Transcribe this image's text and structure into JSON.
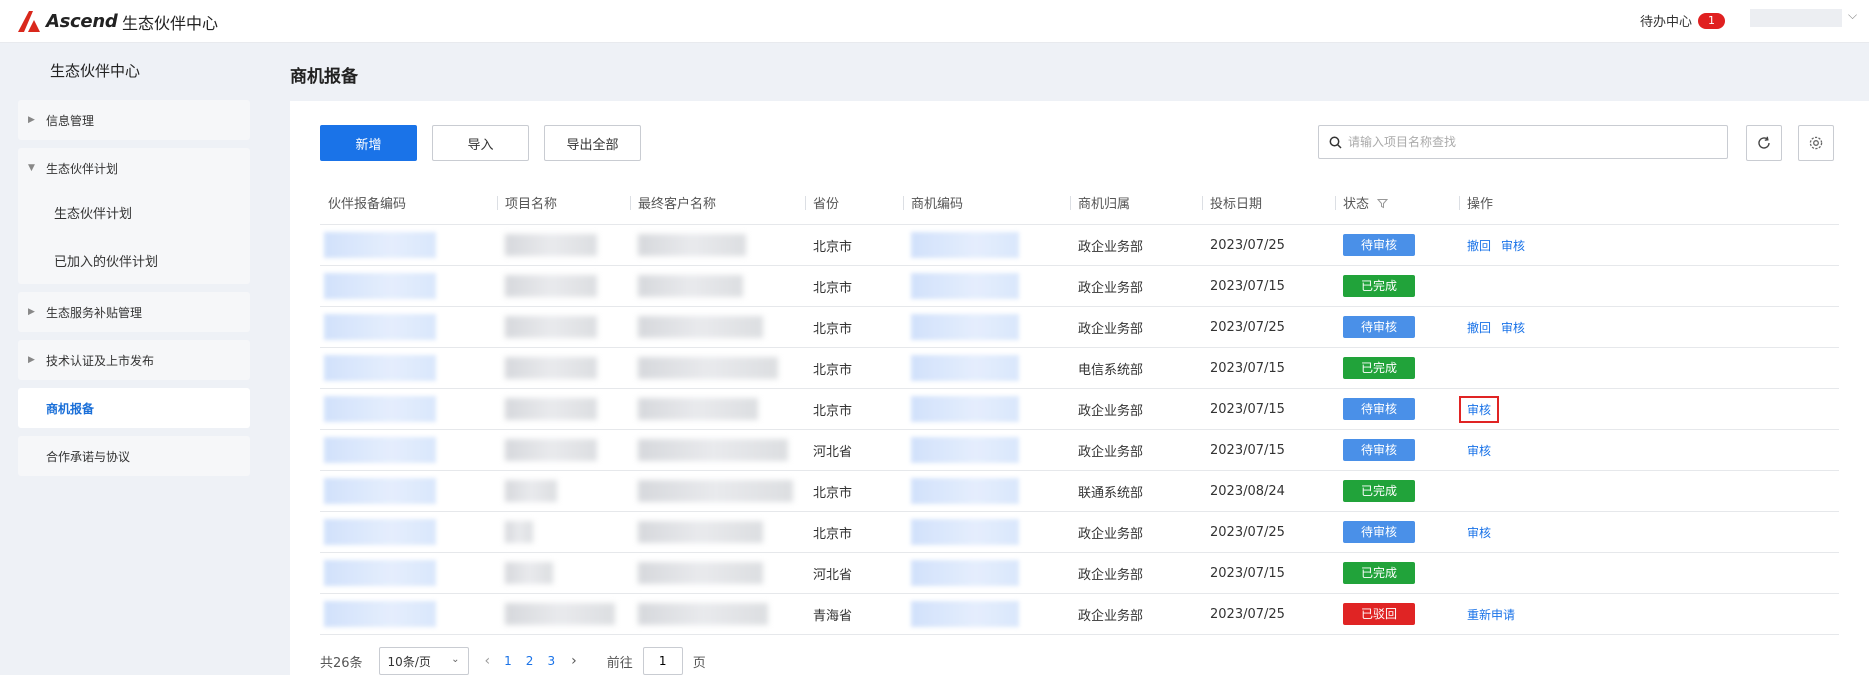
{
  "topbar": {
    "logo_text": "Ascend",
    "app_title": "生态伙伴中心",
    "todo_label": "待办中心",
    "todo_count": "1"
  },
  "sidebar": {
    "title": "生态伙伴中心",
    "groups": [
      {
        "label": "信息管理",
        "expanded": false
      },
      {
        "label": "生态伙伴计划",
        "expanded": true,
        "children": [
          "生态伙伴计划",
          "已加入的伙伴计划"
        ]
      },
      {
        "label": "生态服务补贴管理",
        "expanded": false
      },
      {
        "label": "技术认证及上市发布",
        "expanded": false
      },
      {
        "label": "商机报备",
        "active": true
      },
      {
        "label": "合作承诺与协议"
      }
    ]
  },
  "page": {
    "title": "商机报备",
    "toolbar": {
      "add_label": "新增",
      "import_label": "导入",
      "export_label": "导出全部",
      "search_placeholder": "请输入项目名称查找"
    },
    "table": {
      "columns": [
        "伙伴报备编码",
        "项目名称",
        "最终客户名称",
        "省份",
        "商机编码",
        "商机归属",
        "投标日期",
        "状态",
        "操作"
      ],
      "rows": [
        {
          "province": "北京市",
          "owner": "政企业务部",
          "date": "2023/07/25",
          "status": "待审核",
          "status_kind": "pending",
          "ops": [
            "撤回",
            "审核"
          ]
        },
        {
          "province": "北京市",
          "owner": "政企业务部",
          "date": "2023/07/15",
          "status": "已完成",
          "status_kind": "done",
          "ops": []
        },
        {
          "province": "北京市",
          "owner": "政企业务部",
          "date": "2023/07/25",
          "status": "待审核",
          "status_kind": "pending",
          "ops": [
            "撤回",
            "审核"
          ]
        },
        {
          "province": "北京市",
          "owner": "电信系统部",
          "date": "2023/07/15",
          "status": "已完成",
          "status_kind": "done",
          "ops": []
        },
        {
          "province": "北京市",
          "owner": "政企业务部",
          "date": "2023/07/15",
          "status": "待审核",
          "status_kind": "pending",
          "ops": [
            "审核"
          ],
          "highlight": true
        },
        {
          "province": "河北省",
          "owner": "政企业务部",
          "date": "2023/07/15",
          "status": "待审核",
          "status_kind": "pending",
          "ops": [
            "审核"
          ]
        },
        {
          "province": "北京市",
          "owner": "联通系统部",
          "date": "2023/08/24",
          "status": "已完成",
          "status_kind": "done",
          "ops": []
        },
        {
          "province": "北京市",
          "owner": "政企业务部",
          "date": "2023/07/25",
          "status": "待审核",
          "status_kind": "pending",
          "ops": [
            "审核"
          ]
        },
        {
          "province": "河北省",
          "owner": "政企业务部",
          "date": "2023/07/15",
          "status": "已完成",
          "status_kind": "done",
          "ops": []
        },
        {
          "province": "青海省",
          "owner": "政企业务部",
          "date": "2023/07/25",
          "status": "已驳回",
          "status_kind": "reject",
          "ops": [
            "重新申请"
          ]
        }
      ]
    },
    "pagination": {
      "total": "共26条",
      "page_size": "10条/页",
      "pages": [
        "1",
        "2",
        "3"
      ],
      "goto_label": "前往",
      "current": "1",
      "unit": "页"
    }
  },
  "colors": {
    "primary": "#1a73e8",
    "pending": "#4a90e8",
    "done": "#21a33a",
    "reject": "#e02424"
  }
}
